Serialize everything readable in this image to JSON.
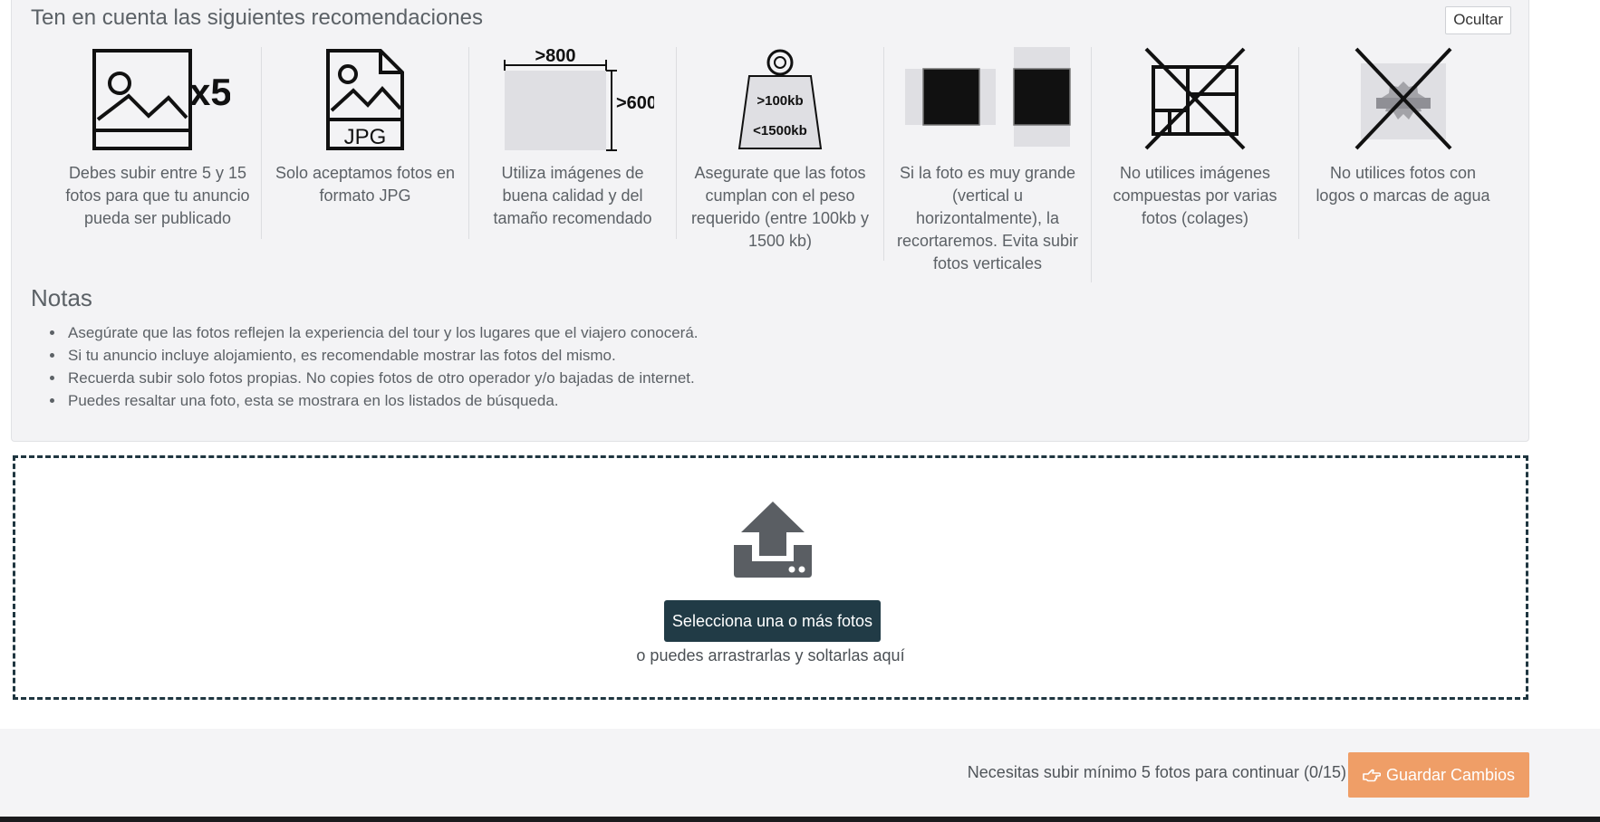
{
  "recommendations": {
    "title": "Ten en cuenta las siguientes recomendaciones",
    "hide_label": "Ocultar",
    "tips": [
      {
        "icon": "image-x5-icon",
        "badge": "x5",
        "text": "Debes subir entre 5 y 15 fotos para que tu anuncio pueda ser publicado"
      },
      {
        "icon": "jpg-file-icon",
        "badge": "JPG",
        "text": "Solo aceptamos fotos en formato JPG"
      },
      {
        "icon": "dimensions-icon",
        "width_label": ">800",
        "height_label": ">600",
        "text": "Utiliza imágenes de buena calidad y del tamaño recomendado"
      },
      {
        "icon": "weight-icon",
        "min_label": ">100kb",
        "max_label": "<1500kb",
        "text": "Asegurate que las fotos cumplan con el peso requerido (entre 100kb y 1500 kb)"
      },
      {
        "icon": "crop-icon",
        "text": "Si la foto es muy grande (vertical u horizontalmente), la recortaremos. Evita subir fotos verticales"
      },
      {
        "icon": "no-collage-icon",
        "text": "No utilices imágenes compuestas por varias fotos (colages)"
      },
      {
        "icon": "no-watermark-icon",
        "text": "No utilices fotos con logos o marcas de agua"
      }
    ]
  },
  "notes": {
    "title": "Notas",
    "items": [
      "Asegúrate que las fotos reflejen la experiencia del tour y los lugares que el viajero conocerá.",
      "Si tu anuncio incluye alojamiento, es recomendable mostrar las fotos del mismo.",
      "Recuerda subir solo fotos propias. No copies fotos de otro operador y/o bajadas de internet.",
      "Puedes resaltar una foto, esta se mostrara en los listados de búsqueda."
    ]
  },
  "dropzone": {
    "icon": "upload-icon",
    "button_label": "Selecciona una o más fotos",
    "hint": "o puedes arrastrarlas y soltarlas aquí"
  },
  "footer": {
    "message": "Necesitas subir mínimo 5 fotos para continuar (0/15)",
    "save_label": "Guardar Cambios",
    "save_icon": "hand-pointer-icon"
  },
  "colors": {
    "panel_bg": "#f3f3f5",
    "primary_button": "#213b46",
    "save_button": "#ef9e67",
    "dropzone_border": "#1f3640"
  }
}
